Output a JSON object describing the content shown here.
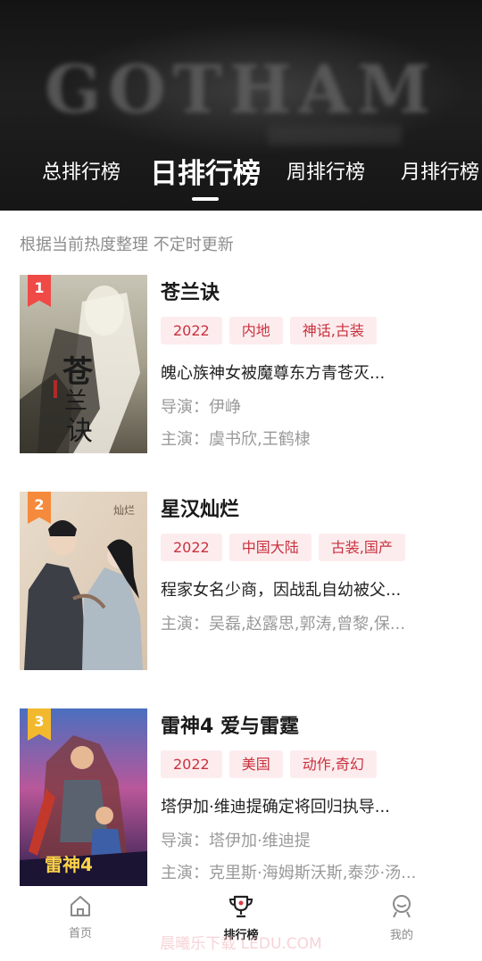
{
  "header": {
    "banner_title": "GOTHAM",
    "tabs": [
      {
        "label": "总排行榜",
        "active": false
      },
      {
        "label": "日排行榜",
        "active": true
      },
      {
        "label": "周排行榜",
        "active": false
      },
      {
        "label": "月排行榜",
        "active": false
      }
    ]
  },
  "notice": "根据当前热度整理 不定时更新",
  "colors": {
    "tag_bg": "#fdecee",
    "tag_text": "#c8323e",
    "rank_1": "#f04a46",
    "rank_2": "#f58a3c",
    "rank_3": "#f2b92f"
  },
  "items": [
    {
      "rank": "1",
      "title": "苍兰诀",
      "tags": [
        "2022",
        "内地",
        "神话,古装"
      ],
      "description": "魄心族神女被魔尊东方青苍灭...",
      "director": "导演：伊峥",
      "cast": "主演：虞书欣,王鹤棣"
    },
    {
      "rank": "2",
      "title": "星汉灿烂",
      "tags": [
        "2022",
        "中国大陆",
        "古装,国产"
      ],
      "description": "程家女名少商，因战乱自幼被父...",
      "cast": "主演：吴磊,赵露思,郭涛,曾黎,保..."
    },
    {
      "rank": "3",
      "title": "雷神4 爱与雷霆",
      "tags": [
        "2022",
        "美国",
        "动作,奇幻"
      ],
      "description": "塔伊加·维迪提确定将回归执导...",
      "director": "导演：塔伊加·维迪提",
      "cast": "主演：克里斯·海姆斯沃斯,泰莎·汤..."
    }
  ],
  "bottom_nav": [
    {
      "label": "首页",
      "icon": "home-icon",
      "active": false
    },
    {
      "label": "排行榜",
      "icon": "trophy-icon",
      "active": true
    },
    {
      "label": "我的",
      "icon": "profile-icon",
      "active": false
    }
  ],
  "watermark": "晨曦乐下载 LEDU.COM"
}
